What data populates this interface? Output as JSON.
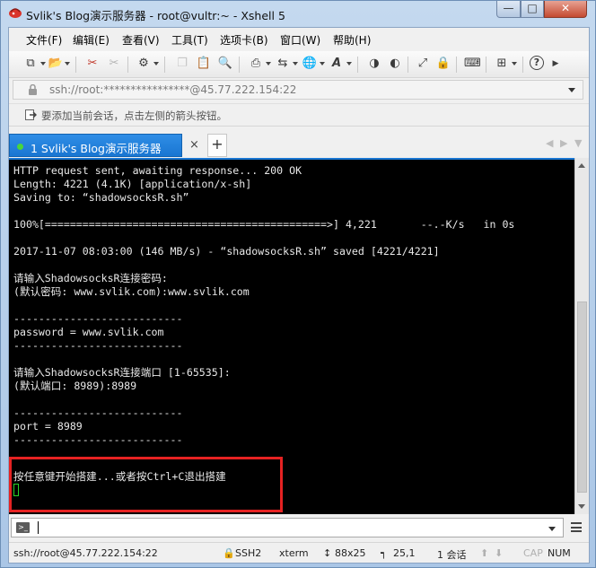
{
  "window": {
    "title": "Svlik's Blog演示服务器 - root@vultr:~ - Xshell 5",
    "controls": {
      "minimize": "—",
      "maximize": "□",
      "close": "✕"
    }
  },
  "menu": [
    "文件(F)",
    "编辑(E)",
    "查看(V)",
    "工具(T)",
    "选项卡(B)",
    "窗口(W)",
    "帮助(H)"
  ],
  "toolbar": {
    "icons": [
      "new-session-icon",
      "open-folder-icon",
      "connect-icon",
      "disconnect-icon",
      "properties-icon",
      "copy-icon",
      "paste-icon",
      "find-icon",
      "print-icon",
      "transfer-icon",
      "globe-icon",
      "font-icon",
      "xftp-icon",
      "xmanager-icon",
      "fullscreen-icon",
      "lock-icon",
      "keyboard-icon",
      "add-icon",
      "help-icon",
      "more-icon"
    ]
  },
  "address": {
    "value": "ssh://root:****************@45.77.222.154:22"
  },
  "hint": {
    "text": "要添加当前会话，点击左侧的箭头按钮。"
  },
  "tabs": {
    "active_label": "1 Svlik's Blog演示服务器",
    "close": "×",
    "add": "+"
  },
  "terminal": {
    "lines": [
      "HTTP request sent, awaiting response... 200 OK",
      "Length: 4221 (4.1K) [application/x-sh]",
      "Saving to: “shadowsocksR.sh”",
      "",
      "100%[=============================================>] 4,221       --.-K/s   in 0s",
      "",
      "2017-11-07 08:03:00 (146 MB/s) - “shadowsocksR.sh” saved [4221/4221]",
      "",
      "请输入ShadowsocksR连接密码:",
      "(默认密码: www.svlik.com):www.svlik.com",
      "",
      "---------------------------",
      "password = www.svlik.com",
      "---------------------------",
      "",
      "请输入ShadowsocksR连接端口 [1-65535]:",
      "(默认端口: 8989):8989",
      "",
      "---------------------------",
      "port = 8989",
      "---------------------------",
      "",
      "",
      "按任意键开始搭建...或者按Ctrl+C退出搭建"
    ]
  },
  "input": {
    "value": ""
  },
  "status": {
    "connection": "ssh://root@45.77.222.154:22",
    "protocol": "SSH2",
    "term": "xterm",
    "size": "88x25",
    "cursor": "25,1",
    "sessions": "1 会话",
    "caps": "CAP",
    "num": "NUM"
  },
  "colors": {
    "accent": "#1976d2",
    "terminal_bg": "#000000",
    "terminal_fg": "#e8e8e8",
    "highlight": "#e52222",
    "cursor": "#28d128",
    "session_dot": "#49d63b"
  }
}
